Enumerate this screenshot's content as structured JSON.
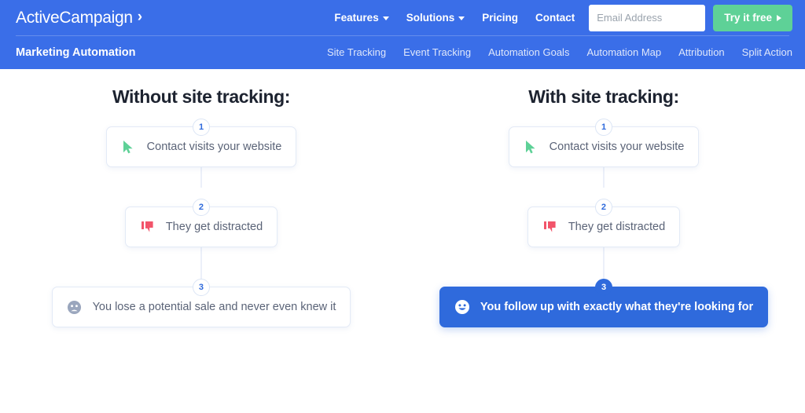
{
  "header": {
    "brand": "ActiveCampaign",
    "brand_chevron": "›",
    "bg_color": "#3a6ee8",
    "nav_links": [
      {
        "label": "Features",
        "has_caret": true
      },
      {
        "label": "Solutions",
        "has_caret": true
      },
      {
        "label": "Pricing",
        "has_caret": false
      },
      {
        "label": "Contact",
        "has_caret": false
      }
    ],
    "email_placeholder": "Email Address",
    "email_value": "",
    "cta_label": "Try it free",
    "cta_color": "#5ed197"
  },
  "subnav": {
    "section_title": "Marketing Automation",
    "links": [
      "Site Tracking",
      "Event Tracking",
      "Automation Goals",
      "Automation Map",
      "Attribution",
      "Split Action"
    ]
  },
  "columns": [
    {
      "heading": "Without site tracking:",
      "steps": [
        {
          "number": "1",
          "icon": "cursor-icon",
          "label": "Contact visits your website",
          "highlight": false
        },
        {
          "number": "2",
          "icon": "thumbs-down-icon",
          "label": "They get distracted",
          "highlight": false
        },
        {
          "number": "3",
          "icon": "sad-face-icon",
          "label": "You lose a potential sale and never even knew it",
          "highlight": false
        }
      ]
    },
    {
      "heading": "With site tracking:",
      "steps": [
        {
          "number": "1",
          "icon": "cursor-icon",
          "label": "Contact visits your website",
          "highlight": false
        },
        {
          "number": "2",
          "icon": "thumbs-down-icon",
          "label": "They get distracted",
          "highlight": false
        },
        {
          "number": "3",
          "icon": "smile-face-icon",
          "label": "You follow up with exactly what they're looking for",
          "highlight": true
        }
      ]
    }
  ],
  "colors": {
    "accent_blue": "#2f6adc",
    "header_blue": "#3a6ee8",
    "green": "#5ed197",
    "pink": "#f2546a",
    "gray_icon": "#9aa6bd",
    "text_dark": "#1d2330",
    "text_body": "#5a6377"
  }
}
